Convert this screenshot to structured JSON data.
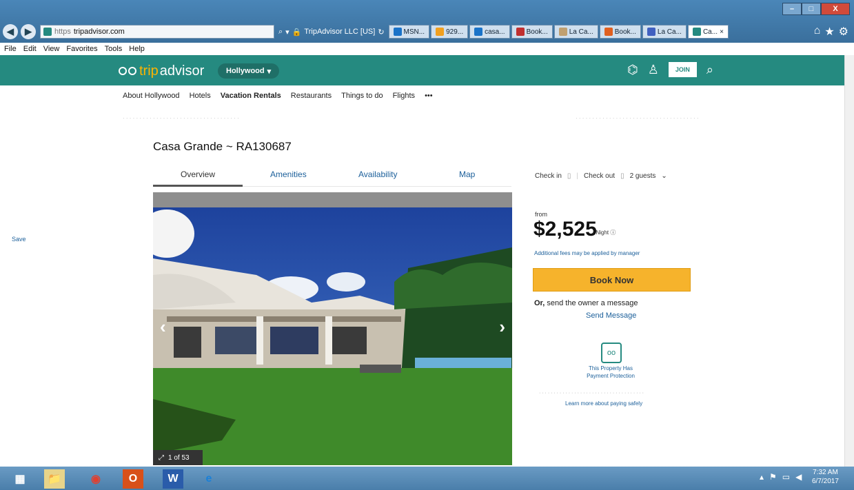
{
  "browser": {
    "address": {
      "scheme": "https",
      "host": "tripadvisor.com"
    },
    "site_identity": "TripAdvisor LLC [US]",
    "tabs": [
      {
        "label": "MSN...",
        "color": "#1a73c8"
      },
      {
        "label": "929...",
        "color": "#f0a020"
      },
      {
        "label": "casa...",
        "color": "#1a73c8"
      },
      {
        "label": "Book...",
        "color": "#c03030"
      },
      {
        "label": "La Ca...",
        "color": "#c0a070"
      },
      {
        "label": "Book...",
        "color": "#e06020"
      },
      {
        "label": "La Ca...",
        "color": "#4060c0"
      },
      {
        "label": "Ca...",
        "color": "#258a80",
        "active": true
      }
    ],
    "menu": [
      "File",
      "Edit",
      "View",
      "Favorites",
      "Tools",
      "Help"
    ]
  },
  "header": {
    "logo_trip": "trip",
    "logo_advisor": "advisor",
    "location": "Hollywood",
    "join_label": "JOIN"
  },
  "nav": {
    "items": [
      "About Hollywood",
      "Hotels",
      "Vacation Rentals",
      "Restaurants",
      "Things to do",
      "Flights",
      "•••"
    ]
  },
  "listing": {
    "title": "Casa Grande ~ RA130687",
    "tabs": [
      "Overview",
      "Amenities",
      "Availability",
      "Map"
    ],
    "save_label": "Save",
    "photo_counter": "1 of 53"
  },
  "booking": {
    "checkin": "Check in",
    "checkout": "Check out",
    "guests": "2 guests",
    "from": "from",
    "price": "$2,525",
    "per_night": "/ Night",
    "fees_note": "Additional fees may be applied by manager",
    "book_now": "Book Now",
    "or_prefix": "Or,",
    "or_text": "send the owner a message",
    "send_message": "Send Message",
    "protection_line1": "This Property Has",
    "protection_line2": "Payment Protection",
    "learn_more": "Learn more about paying safely"
  },
  "taskbar": {
    "time": "7:32 AM",
    "date": "6/7/2017"
  }
}
